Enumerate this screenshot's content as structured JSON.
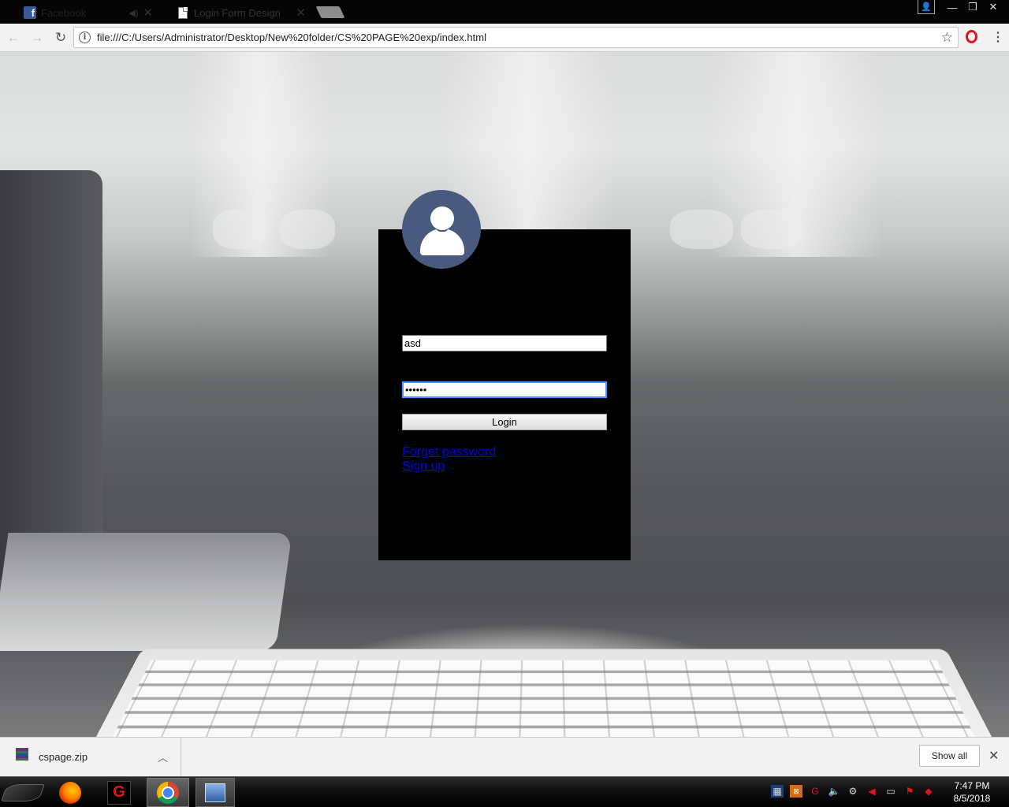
{
  "browser": {
    "tabs": [
      {
        "title": "Facebook",
        "active": false,
        "icon": "facebook-icon",
        "audio": true
      },
      {
        "title": "Login Form Design",
        "active": true,
        "icon": "page-icon"
      }
    ],
    "url": "file:///C:/Users/Administrator/Desktop/New%20folder/CS%20PAGE%20exp/index.html"
  },
  "login": {
    "username": "asd",
    "password": "••••••",
    "button_label": "Login",
    "forget_link": "Forget password",
    "signup_link": "Sign up"
  },
  "downloads": {
    "file_name": "cspage.zip",
    "show_all_label": "Show all"
  },
  "taskbar": {
    "time": "7:47 PM",
    "date": "8/5/2018"
  },
  "colors": {
    "avatar_bg": "#4a5a7e",
    "link": "#0000ee",
    "focus_ring": "#4d90fe",
    "card_bg": "#000000"
  }
}
